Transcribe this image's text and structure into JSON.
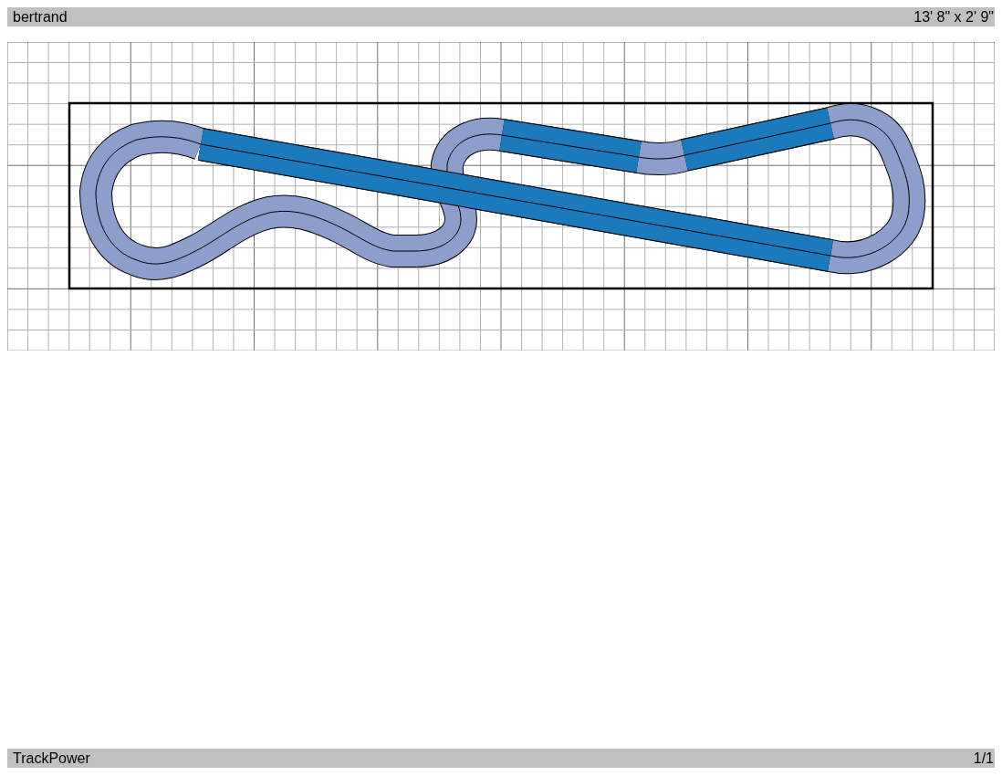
{
  "header": {
    "title": "bertrand",
    "dimensions": "13' 8\" x 2' 9\""
  },
  "footer": {
    "app_name": "TrackPower",
    "page": "1/1"
  }
}
